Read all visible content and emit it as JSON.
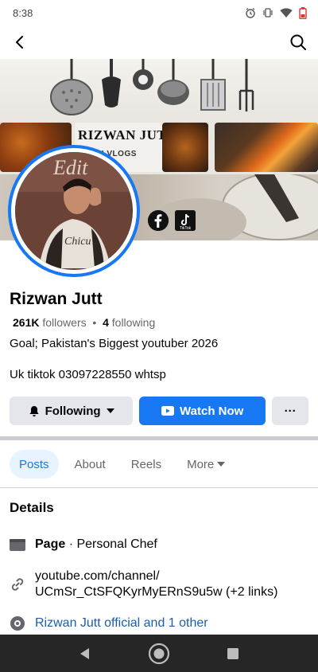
{
  "status_bar": {
    "time": "8:38",
    "icons": [
      "alarm-icon",
      "vibrate-icon",
      "wifi-icon",
      "battery-icon"
    ]
  },
  "header": {
    "back_icon": "back-arrow-icon",
    "search_icon": "search-icon"
  },
  "cover": {
    "banner_title": "RIZWAN JUTT",
    "banner_subtitle": "MINI VLOGS",
    "avatar_overlay_text": "Edit",
    "tiktok_label": "TikTok",
    "social_icons": [
      "facebook-icon",
      "tiktok-icon"
    ]
  },
  "profile": {
    "name": "Rizwan Jutt",
    "followers_count": "261K",
    "followers_label": "followers",
    "separator": "•",
    "following_count": "4",
    "following_label": "following",
    "bio_line_1": "Goal; Pakistan's Biggest youtuber 2026",
    "bio_line_2": "Uk tiktok 03097228550 whtsp"
  },
  "actions": {
    "following_label": "Following",
    "watch_label": "Watch Now",
    "more_label": "···"
  },
  "tabs": [
    {
      "label": "Posts",
      "active": true
    },
    {
      "label": "About",
      "active": false
    },
    {
      "label": "Reels",
      "active": false
    },
    {
      "label": "More",
      "active": false
    }
  ],
  "details": {
    "title": "Details",
    "page_label": "Page",
    "page_category": " · Personal Chef",
    "link_line_1": "youtube.com/channel/",
    "link_line_2": "UCmSr_CtSFQKyrMyERnS9u5w (+2 links)",
    "official_text": "Rizwan Jutt official and 1 other"
  },
  "colors": {
    "brand_blue": "#1877f2",
    "secondary_button": "#e4e6eb",
    "muted_text": "#65676b",
    "link_text": "#1a5dae"
  }
}
